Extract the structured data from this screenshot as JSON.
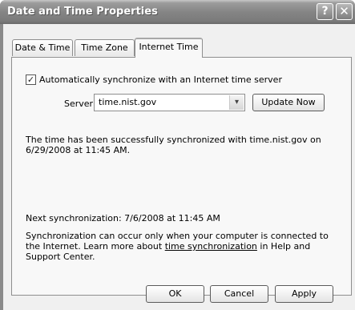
{
  "window": {
    "title": "Date and Time Properties"
  },
  "title_buttons": {
    "help": "?",
    "close": "✕"
  },
  "tabs": [
    {
      "label": "Date & Time",
      "selected": false
    },
    {
      "label": "Time Zone",
      "selected": false
    },
    {
      "label": "Internet Time",
      "selected": true
    }
  ],
  "sync": {
    "checkbox_label": "Automatically synchronize with an Internet time server",
    "checked": true,
    "check_glyph": "✓",
    "server_label": "Server:",
    "server_value": "time.nist.gov",
    "dropdown_glyph": "▾",
    "update_button": "Update Now"
  },
  "status": {
    "message": "The time has been successfully synchronized with time.nist.gov on 6/29/2008 at 11:45 AM.",
    "next_sync": "Next synchronization: 7/6/2008 at 11:45 AM"
  },
  "note": {
    "before": "Synchronization can occur only when your computer is connected to the Internet.  Learn more about ",
    "link": "time synchronization",
    "after": " in Help and Support Center."
  },
  "buttons": {
    "ok": "OK",
    "cancel": "Cancel",
    "apply": "Apply"
  }
}
